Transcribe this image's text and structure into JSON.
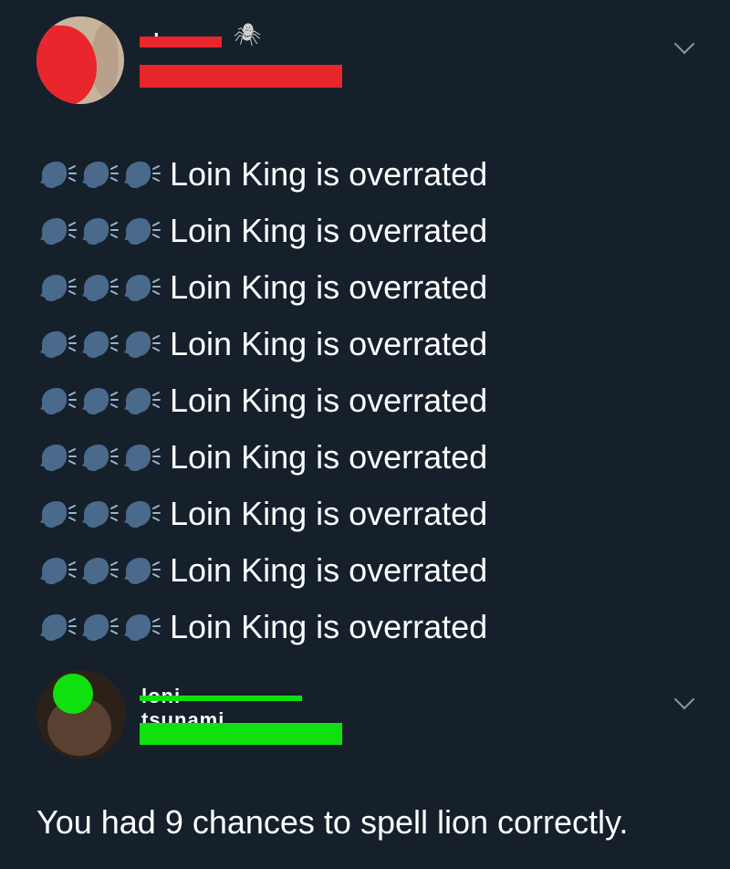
{
  "tweet1": {
    "display_name": "chase",
    "name_emoji": "🕷",
    "lines": [
      "Loin King is overrated",
      "Loin King is overrated",
      "Loin King is overrated",
      "Loin King is overrated",
      "Loin King is overrated",
      "Loin King is overrated",
      "Loin King is overrated",
      "Loin King is overrated",
      "Loin King is overrated"
    ],
    "line_emoji": "speaking-head-icon",
    "emoji_count_per_line": 3,
    "redaction_color": "#e8262b"
  },
  "tweet2": {
    "display_name": "loni tsunami",
    "reply": "You had 9 chances to spell lion correctly.",
    "redaction_color": "#10e010"
  },
  "colors": {
    "background": "#15202b",
    "text": "#ffffff",
    "muted": "#8899a6",
    "emoji_head": "#4a6a8c"
  }
}
